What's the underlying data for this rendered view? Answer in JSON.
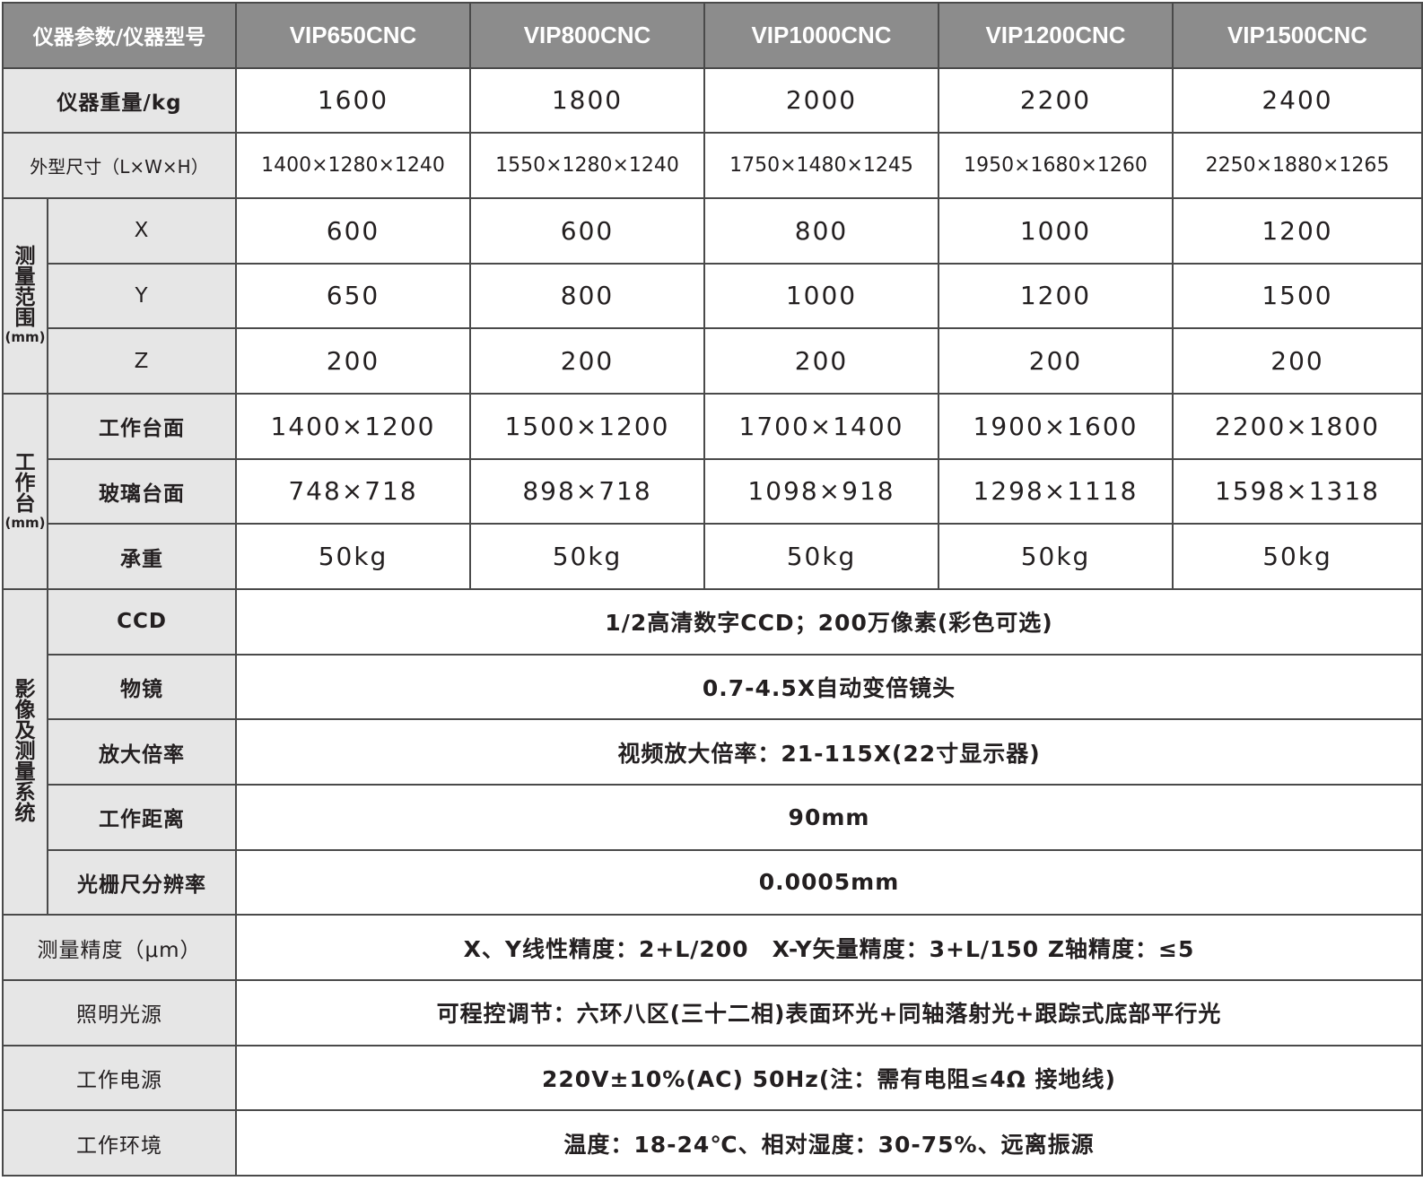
{
  "header": {
    "corner": "仪器参数/仪器型号",
    "models": [
      "VIP650CNC",
      "VIP800CNC",
      "VIP1000CNC",
      "VIP1200CNC",
      "VIP1500CNC"
    ]
  },
  "weight": {
    "label": "仪器重量/kg",
    "values": [
      "1600",
      "1800",
      "2000",
      "2200",
      "2400"
    ]
  },
  "dimensions": {
    "label": "外型尺寸（L×W×H）",
    "values": [
      "1400×1280×1240",
      "1550×1280×1240",
      "1750×1480×1245",
      "1950×1680×1260",
      "2250×1880×1265"
    ]
  },
  "range": {
    "group_label": "测量范围",
    "unit": "(mm)",
    "rows": [
      {
        "label": "X",
        "values": [
          "600",
          "600",
          "800",
          "1000",
          "1200"
        ]
      },
      {
        "label": "Y",
        "values": [
          "650",
          "800",
          "1000",
          "1200",
          "1500"
        ]
      },
      {
        "label": "Z",
        "values": [
          "200",
          "200",
          "200",
          "200",
          "200"
        ]
      }
    ]
  },
  "worktable": {
    "group_label": "工作台",
    "unit": "(mm)",
    "rows": [
      {
        "label": "工作台面",
        "values": [
          "1400×1200",
          "1500×1200",
          "1700×1400",
          "1900×1600",
          "2200×1800"
        ]
      },
      {
        "label": "玻璃台面",
        "values": [
          "748×718",
          "898×718",
          "1098×918",
          "1298×1118",
          "1598×1318"
        ]
      },
      {
        "label": "承重",
        "values": [
          "50kg",
          "50kg",
          "50kg",
          "50kg",
          "50kg"
        ]
      }
    ]
  },
  "imaging": {
    "group_label": "影像及测量系统",
    "rows": [
      {
        "label": "CCD",
        "value": "1/2高清数字CCD；200万像素(彩色可选)"
      },
      {
        "label": "物镜",
        "value": "0.7-4.5X自动变倍镜头"
      },
      {
        "label": "放大倍率",
        "value": "视频放大倍率：21-115X(22寸显示器)"
      },
      {
        "label": "工作距离",
        "value": "90mm"
      },
      {
        "label": "光栅尺分辨率",
        "value": "0.0005mm"
      }
    ]
  },
  "footer_rows": [
    {
      "label": "测量精度（μm）",
      "value": "X、Y线性精度：2+L/200　X-Y矢量精度：3+L/150  Z轴精度：≤5"
    },
    {
      "label": "照明光源",
      "value": "可程控调节：六环八区(三十二相)表面环光+同轴落射光+跟踪式底部平行光"
    },
    {
      "label": "工作电源",
      "value": "220V±10%(AC)  50Hz(注：需有电阻≤4Ω 接地线)"
    },
    {
      "label": "工作环境",
      "value": "温度：18-24℃、相对湿度：30-75%、远离振源"
    }
  ]
}
